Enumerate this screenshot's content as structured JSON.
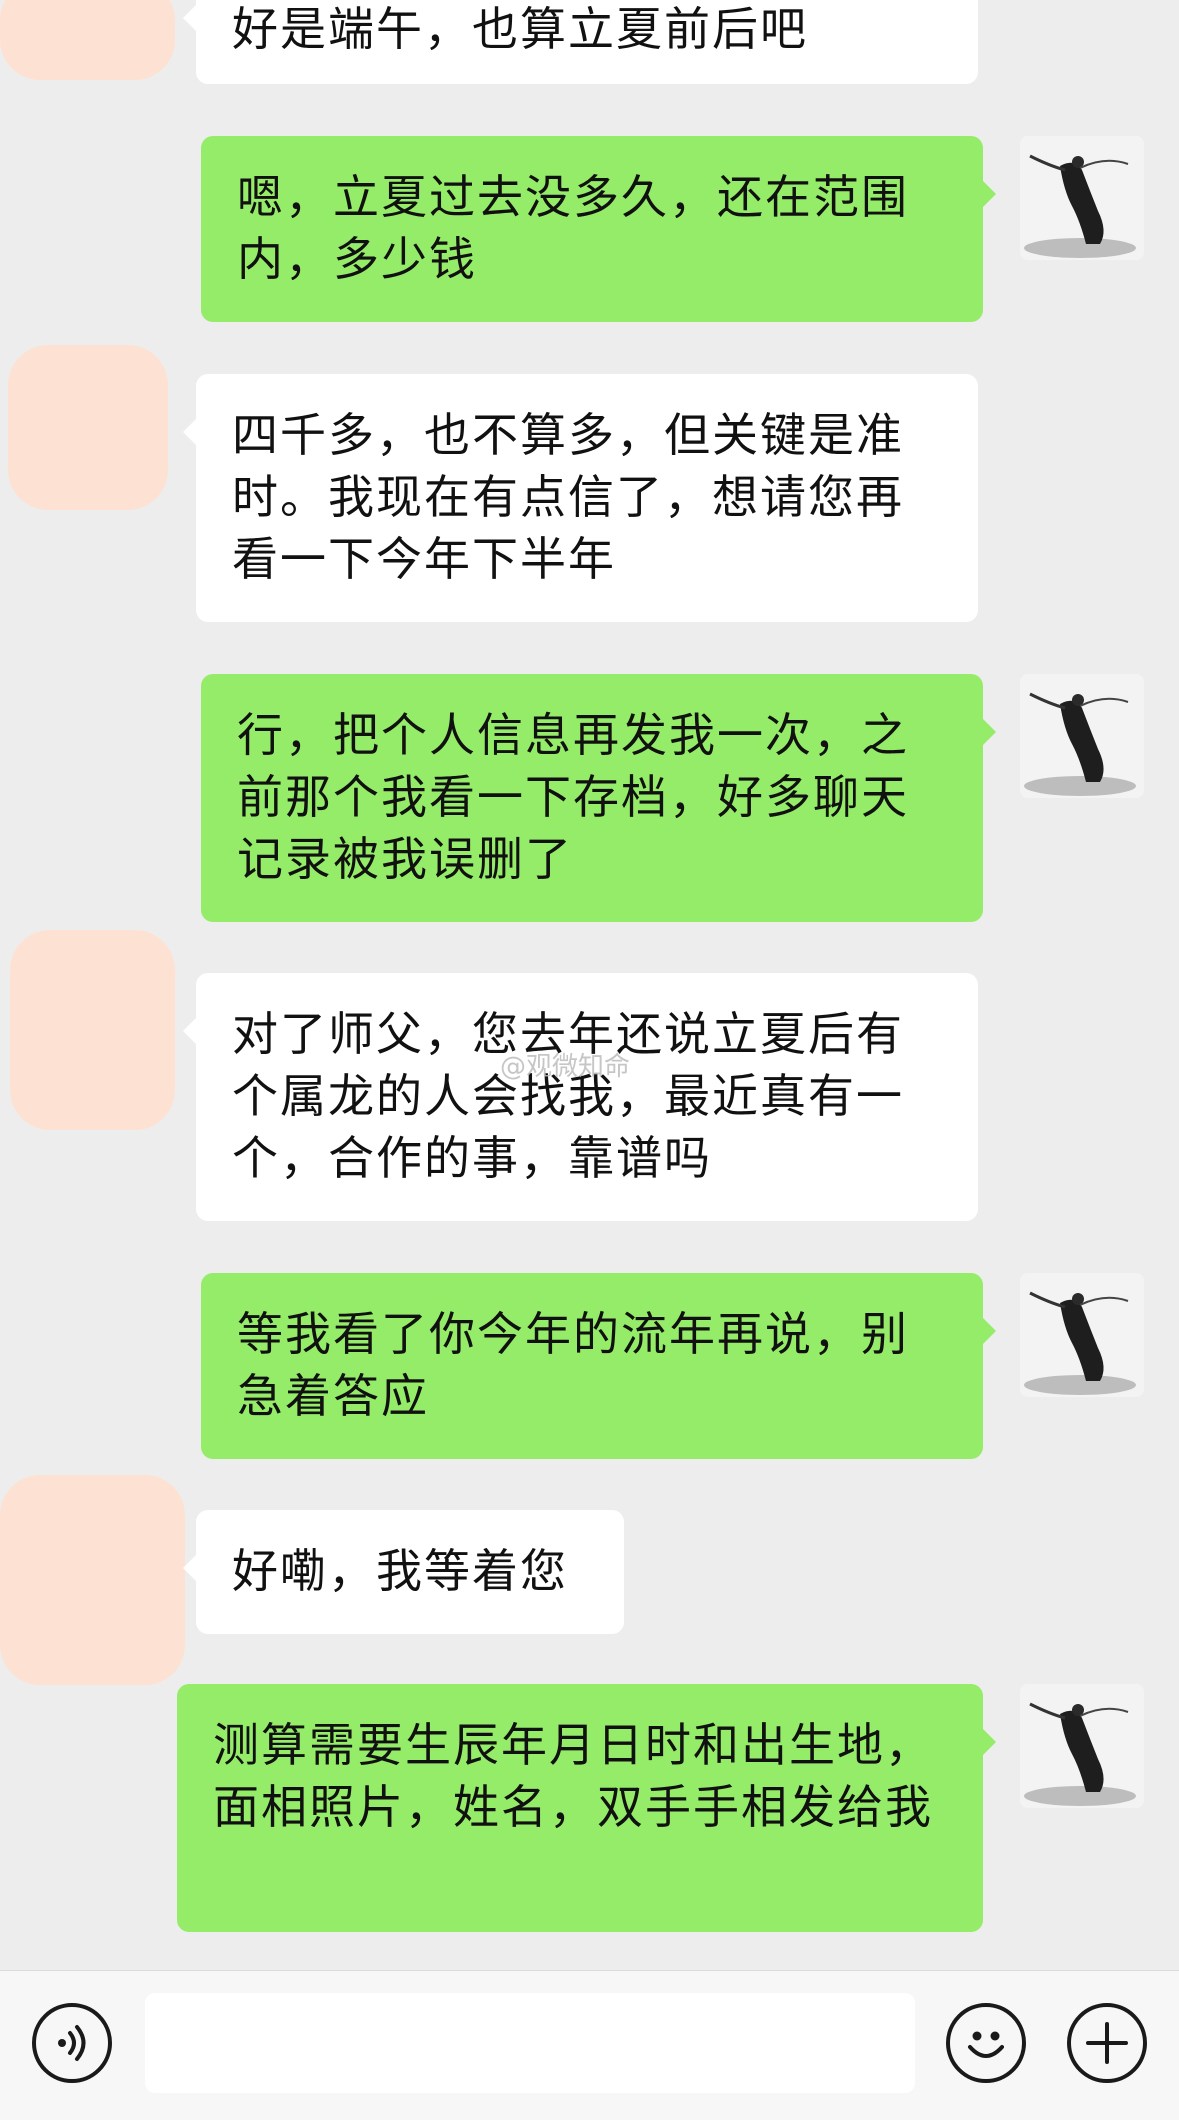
{
  "messages": [
    {
      "side": "left",
      "text": "好是端午，也算立夏前后吧"
    },
    {
      "side": "right",
      "text": "嗯，立夏过去没多久，还在范围内，多少钱"
    },
    {
      "side": "left",
      "text": "四千多，也不算多，但关键是准时。我现在有点信了，想请您再看一下今年下半年"
    },
    {
      "side": "right",
      "text": "行，把个人信息再发我一次，之前那个我看一下存档，好多聊天记录被我误删了"
    },
    {
      "side": "left",
      "text": "对了师父，您去年还说立夏后有个属龙的人会找我，最近真有一个，合作的事，靠谱吗"
    },
    {
      "side": "right",
      "text": "等我看了你今年的流年再说，别急着答应"
    },
    {
      "side": "left",
      "text": "好嘞，我等着您"
    },
    {
      "side": "right",
      "text": "测算需要生辰年月日时和出生地，面相照片，姓名，双手手相发给我"
    }
  ],
  "watermark": "@观微知命",
  "input": {
    "value": "",
    "placeholder": ""
  },
  "icons": {
    "voice": "voice-icon",
    "emoji": "emoji-icon",
    "plus": "plus-icon"
  },
  "colors": {
    "background": "#ededed",
    "sent_bubble": "#95ec69",
    "received_bubble": "#ffffff"
  }
}
